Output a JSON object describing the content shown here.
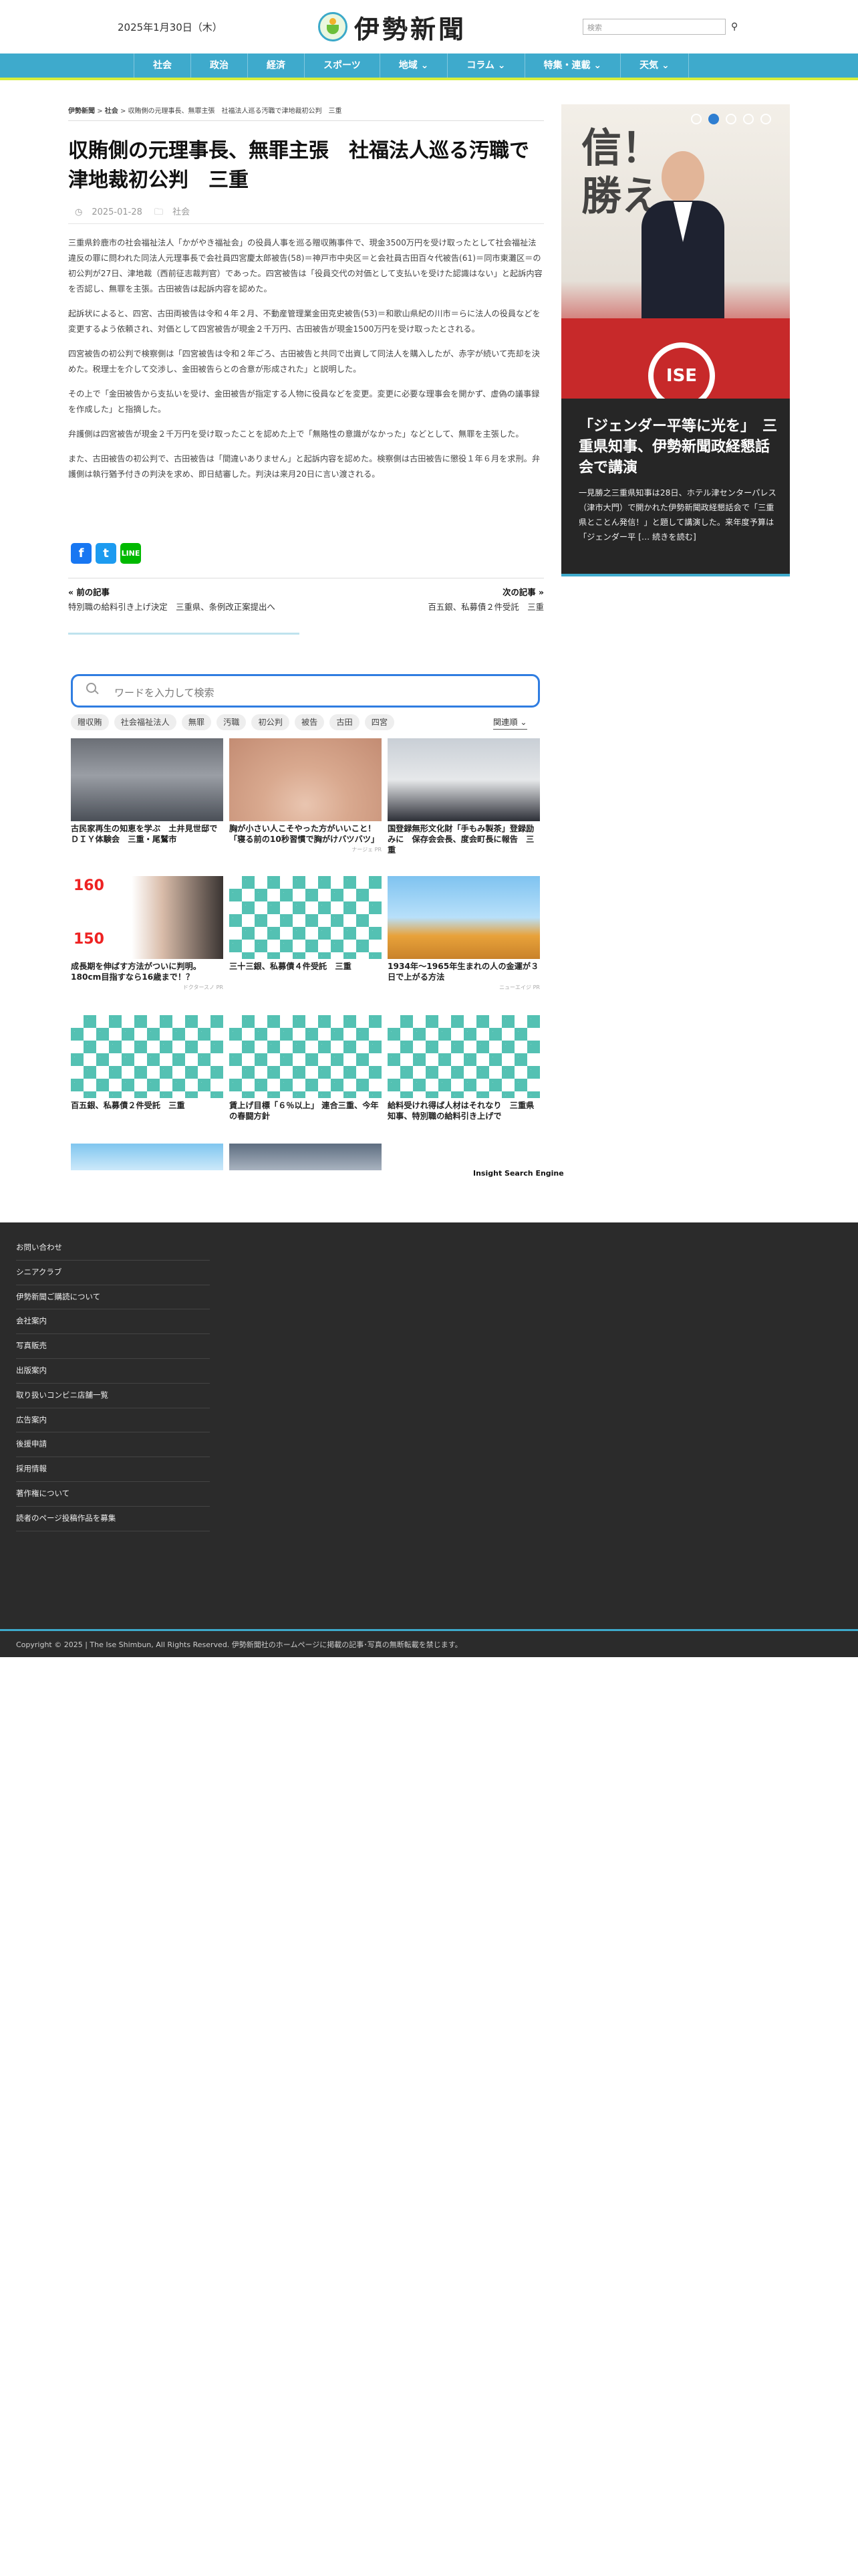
{
  "header": {
    "date": "2025年1月30日（木）",
    "logo_text": "伊勢新聞",
    "logo_badge": "伊勢新聞",
    "search_placeholder": "検索",
    "search_icon": "search-icon"
  },
  "nav": {
    "items": [
      "社会",
      "政治",
      "経済",
      "スポーツ",
      "地域 ⌄",
      "コラム ⌄",
      "特集・連載 ⌄",
      "天気 ⌄"
    ]
  },
  "breadcrumb": {
    "home": "伊勢新聞",
    "category": "社会",
    "current": "収賄側の元理事長、無罪主張　社福法人巡る汚職で津地裁初公判　三重",
    "separator": ">"
  },
  "article": {
    "title": "収賄側の元理事長、無罪主張　社福法人巡る汚職で津地裁初公判　三重",
    "date": "2025-01-28",
    "category": "社会",
    "paragraphs": [
      "三重県鈴鹿市の社会福祉法人「かがやき福祉会」の役員人事を巡る贈収賄事件で、現金3500万円を受け取ったとして社会福祉法違反の罪に問われた同法人元理事長で会社員四宮慶太郎被告(58)＝神戸市中央区＝と会社員古田百々代被告(61)＝同市東灘区＝の初公判が27日、津地裁（西前征志裁判官）であった。四宮被告は「役員交代の対価として支払いを受けた認識はない」と起訴内容を否認し、無罪を主張。古田被告は起訴内容を認めた。",
      "起訴状によると、四宮、古田両被告は令和４年２月、不動産管理業金田克史被告(53)＝和歌山県紀の川市＝らに法人の役員などを変更するよう依頼され、対価として四宮被告が現金２千万円、古田被告が現金1500万円を受け取ったとされる。",
      "四宮被告の初公判で検察側は「四宮被告は令和２年ごろ、古田被告と共同で出資して同法人を購入したが、赤字が続いて売却を決めた。税理士を介して交渉し、金田被告らとの合意が形成された」と説明した。",
      "その上で「金田被告から支払いを受け、金田被告が指定する人物に役員などを変更。変更に必要な理事会を開かず、虚偽の議事録を作成した」と指摘した。",
      "弁護側は四宮被告が現金２千万円を受け取ったことを認めた上で「無賂性の意識がなかった」などとして、無罪を主張した。",
      "また、古田被告の初公判で、古田被告は「間違いありません」と起訴内容を認めた。検察側は古田被告に懲役１年６月を求刑。弁護側は執行猶予付きの判決を求め、即日結審した。判決は来月20日に言い渡される。"
    ]
  },
  "share": {
    "facebook": "f",
    "twitter": "t",
    "line": "LINE"
  },
  "post_nav": {
    "prev_label": "« 前の記事",
    "prev_title": "特別職の給料引き上げ決定　三重県、条例改正案提出へ",
    "next_label": "次の記事 »",
    "next_title": "百五銀、私募債２件受託　三重"
  },
  "insight": {
    "placeholder": "ワードを入力して検索",
    "tags": [
      "贈収賄",
      "社会福祉法人",
      "無罪",
      "汚職",
      "初公判",
      "被告",
      "古田",
      "四宮"
    ],
    "sort_label": "関連順 ⌄",
    "brand": "Insight Search Engine",
    "cards": [
      {
        "caption": "古民家再生の知恵を学ぶ　土井見世邸でＤＩＹ体験会　三重・尾鷲市",
        "source": ""
      },
      {
        "caption": "胸が小さい人こそやった方がいいこと！「寝る前の10秒習慣で胸がけバツバツ」",
        "source": "ナージェ PR"
      },
      {
        "caption": "国登録無形文化財「手もみ製茶」登録励みに　保存会会長、度会町長に報告　三重",
        "source": ""
      },
      {
        "caption": "成長期を伸ばす方法がついに判明。180cm目指すなら16歳まで！？",
        "source": "ドクタースノ PR"
      },
      {
        "caption": "三十三銀、私募債４件受託　三重",
        "source": ""
      },
      {
        "caption": "1934年〜1965年生まれの人の金運が３日で上がる方法",
        "source": "ニューエイジ PR"
      },
      {
        "caption": "百五銀、私募債２件受託　三重",
        "source": ""
      },
      {
        "caption": "賃上げ目標「６％以上」 連合三重、今年の春闘方針",
        "source": ""
      },
      {
        "caption": "給料受けれ得ば人材はそれなり　三重県知事、特別職の給料引き上げで",
        "source": ""
      }
    ],
    "num_a": "160",
    "num_b": "150"
  },
  "sidebar": {
    "calligraphy": "信！\n勝え",
    "badge": "ISE",
    "slide_count": 5,
    "active_slide": 2,
    "headline": "「ジェンダー平等に光を」　三重県知事、伊勢新聞政経懇話会で講演",
    "excerpt": "一見勝之三重県知事は28日、ホテル津センターパレス（津市大門）で開かれた伊勢新聞政経懇話会で「三重県とことん発信！」と題して講演した。来年度予算は「ジェンダー平 [… 続きを読む]"
  },
  "footer": {
    "links": [
      "お問い合わせ",
      "シニアクラブ",
      "伊勢新聞ご購読について",
      "会社案内",
      "写真販売",
      "出版案内",
      "取り扱いコンビニ店舗一覧",
      "広告案内",
      "後援申請",
      "採用情報",
      "著作権について",
      "読者のページ投稿作品を募集"
    ],
    "copyright": "Copyright © 2025 | The Ise Shimbun, All Rights Reserved. 伊勢新聞社のホームページに掲載の記事･写真の無断転載を禁じます。"
  },
  "colors": {
    "nav": "#3eaacc",
    "nav_accent": "#d8ee3a",
    "search_border": "#2f7de1",
    "footer": "#2b2b2b"
  }
}
